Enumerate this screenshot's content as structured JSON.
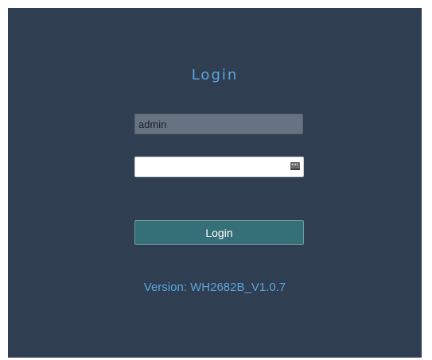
{
  "login": {
    "title": "Login",
    "username_value": "admin",
    "password_value": "",
    "button_label": "Login",
    "version_text": "Version: WH2682B_V1.0.7"
  },
  "icons": {
    "password_field_icon": "keyboard-icon"
  },
  "colors": {
    "panel_background": "#2f3e50",
    "accent_text": "#5aa6e0",
    "button_background": "#356f77",
    "username_field_background": "#687381"
  }
}
